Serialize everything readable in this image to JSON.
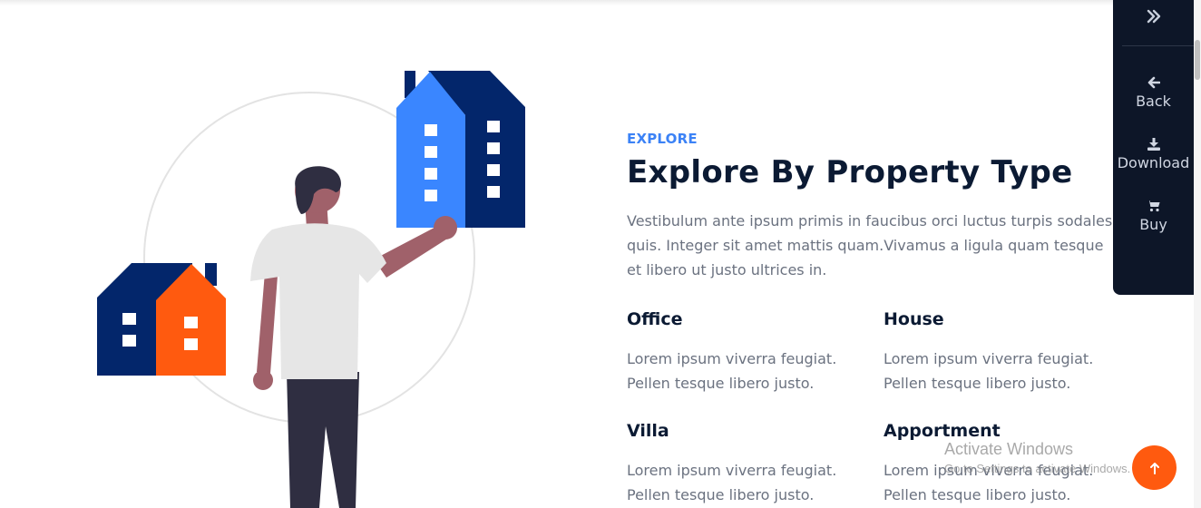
{
  "section": {
    "eyebrow": "EXPLORE",
    "title": "Explore By Property Type",
    "intro": "Vestibulum ante ipsum primis in faucibus orci luctus turpis sodales quis. Integer sit amet mattis quam.Vivamus a ligula quam tesque et libero ut justo ultrices in."
  },
  "property_types": [
    {
      "title": "Office",
      "description": "Lorem ipsum viverra feugiat. Pellen tesque libero justo."
    },
    {
      "title": "House",
      "description": "Lorem ipsum viverra feugiat. Pellen tesque libero justo."
    },
    {
      "title": "Villa",
      "description": "Lorem ipsum viverra feugiat. Pellen tesque libero justo."
    },
    {
      "title": "Apportment",
      "description": "Lorem ipsum viverra feugiat. Pellen tesque libero justo."
    }
  ],
  "side_panel": {
    "collapse_icon": "double-chevron-right-icon",
    "items": [
      {
        "label": "Back",
        "icon": "arrow-left-icon"
      },
      {
        "label": "Download",
        "icon": "download-icon"
      },
      {
        "label": "Buy",
        "icon": "cart-icon"
      }
    ]
  },
  "watermark": {
    "title": "Activate Windows",
    "subtitle": "Go to Settings to activate Windows."
  },
  "scroll_top": {
    "icon": "arrow-up-icon"
  },
  "colors": {
    "accent_blue": "#3b82f6",
    "navy": "#0b1a33",
    "orange": "#ff5a0f",
    "panel_bg": "#0d1628",
    "building_navy": "#03266b",
    "building_blue": "#3a86ff"
  }
}
